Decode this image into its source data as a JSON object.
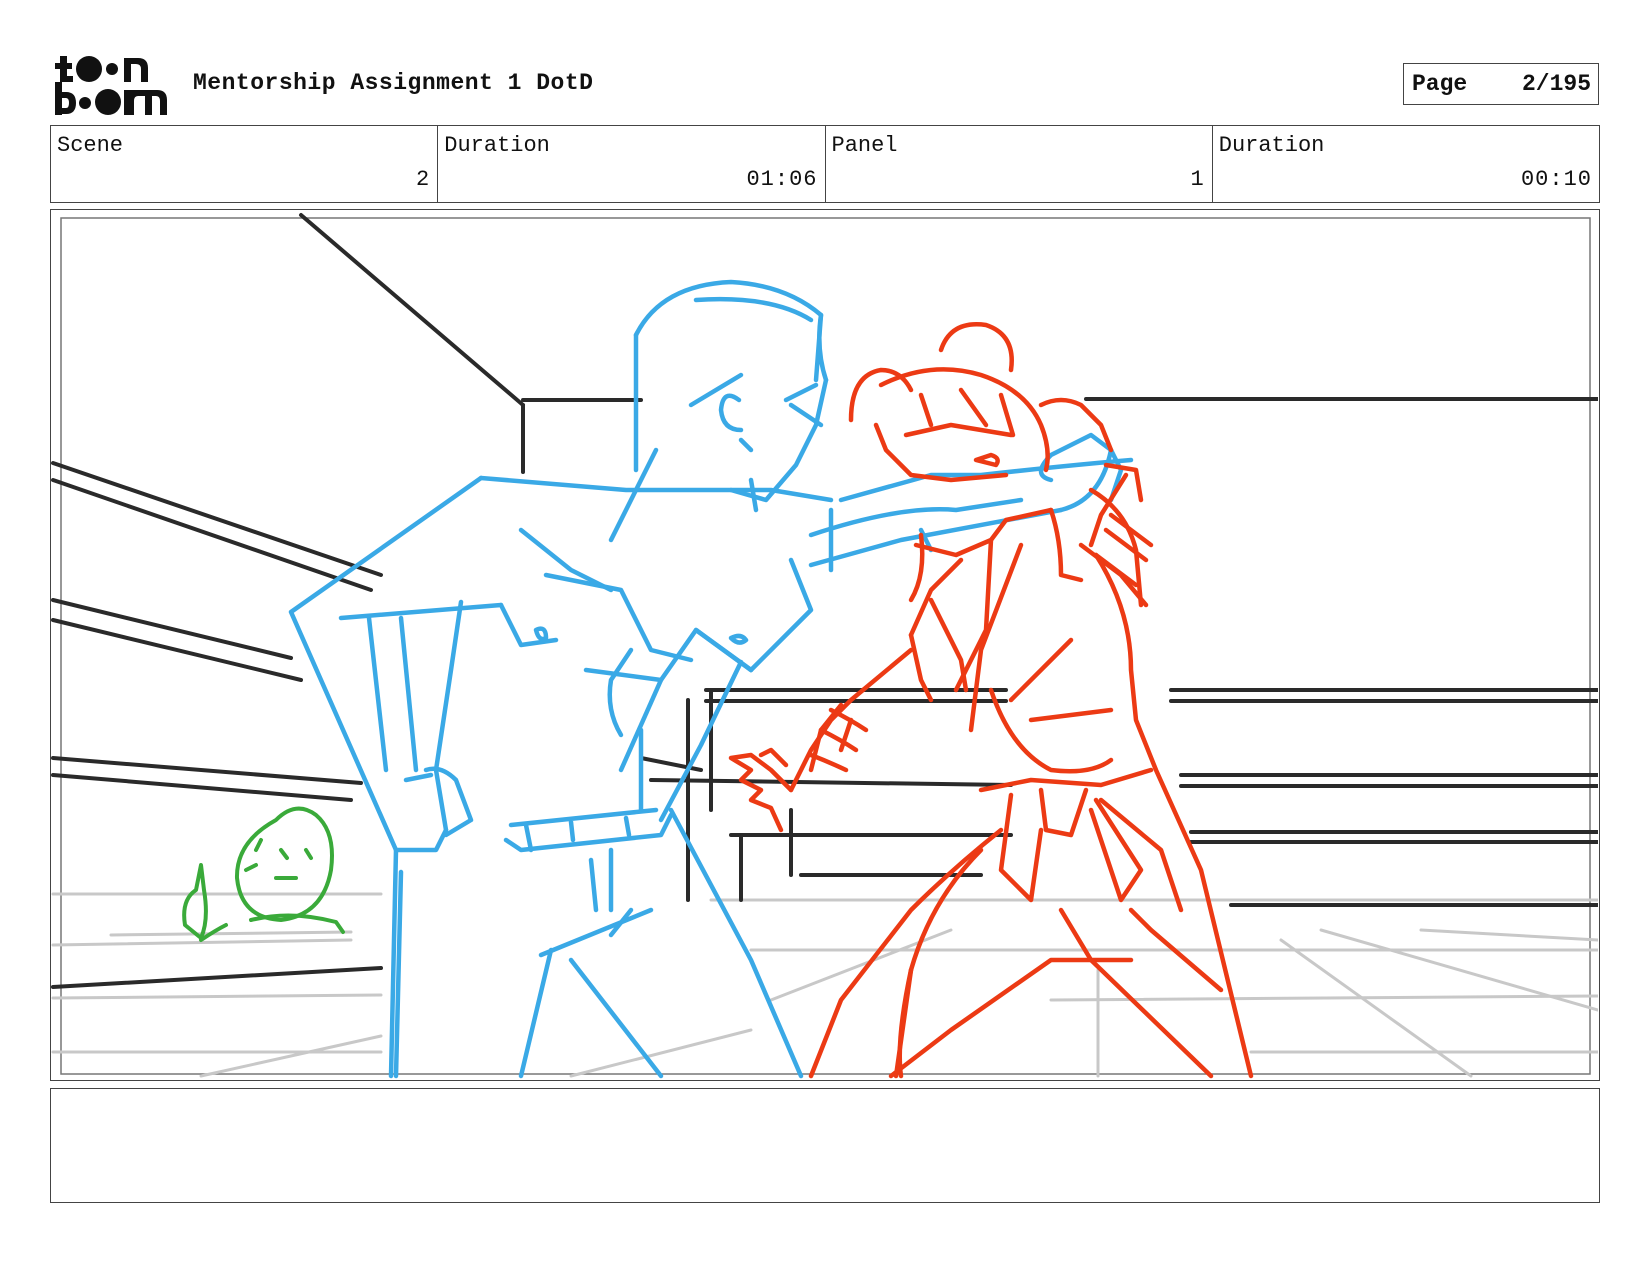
{
  "logo": {
    "name": "toon boom",
    "icon": "toonboom-logo"
  },
  "document": {
    "title": "Mentorship Assignment 1 DotD"
  },
  "page": {
    "label": "Page",
    "value": "2/195"
  },
  "info": [
    {
      "label": "Scene",
      "value": "2"
    },
    {
      "label": "Duration",
      "value": "01:06"
    },
    {
      "label": "Panel",
      "value": "1"
    },
    {
      "label": "Duration",
      "value": "00:10"
    }
  ],
  "panel": {
    "content": "storyboard-sketch",
    "colors": {
      "ring": "#2a2a2a",
      "floor": "#c8c8c8",
      "blue_fighter": "#3aa9e6",
      "red_fighter": "#ec3a14",
      "referee": "#3aaa3a"
    }
  },
  "notes": {
    "text": ""
  }
}
